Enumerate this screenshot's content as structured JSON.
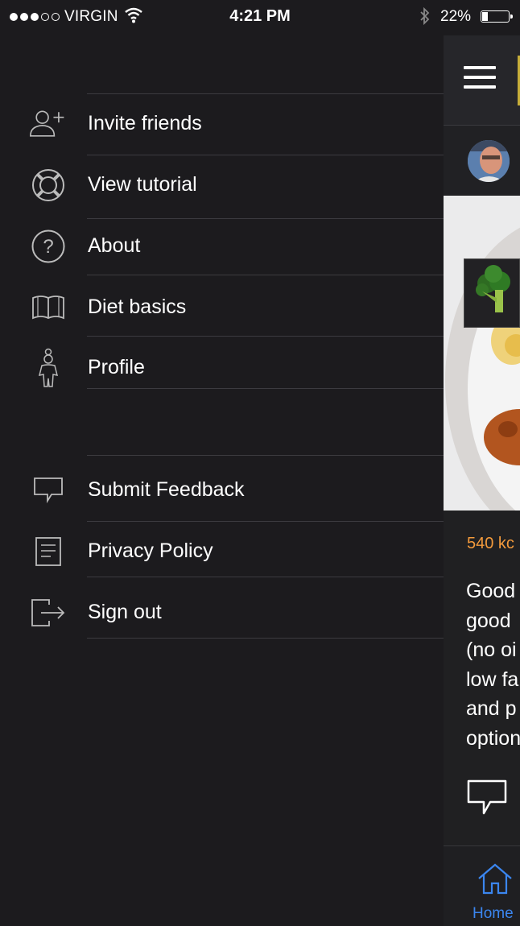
{
  "status_bar": {
    "carrier": "VIRGIN",
    "time": "4:21 PM",
    "battery": "22%",
    "signal_bars_filled": 3,
    "signal_bars_total": 5
  },
  "menu": {
    "items": [
      {
        "label": "Invite friends",
        "icon": "add-user-icon"
      },
      {
        "label": "View tutorial",
        "icon": "lifebuoy-icon"
      },
      {
        "label": "About",
        "icon": "question-icon"
      },
      {
        "label": "Diet basics",
        "icon": "book-icon"
      },
      {
        "label": "Profile",
        "icon": "chef-icon"
      }
    ],
    "secondary_items": [
      {
        "label": "Submit Feedback",
        "icon": "speech-bubble-icon"
      },
      {
        "label": "Privacy Policy",
        "icon": "document-icon"
      },
      {
        "label": "Sign out",
        "icon": "sign-out-icon"
      }
    ]
  },
  "main": {
    "kcal": "540 kc",
    "description": "Good\ngood\n(no oi\nlow fa\nand p\noption",
    "tab_home": "Home"
  },
  "colors": {
    "background": "#1c1b1e",
    "divider": "#3c3b40",
    "kcal": "#f39a3c",
    "tab_active": "#3b86f0",
    "accent": "#c6ad39"
  }
}
